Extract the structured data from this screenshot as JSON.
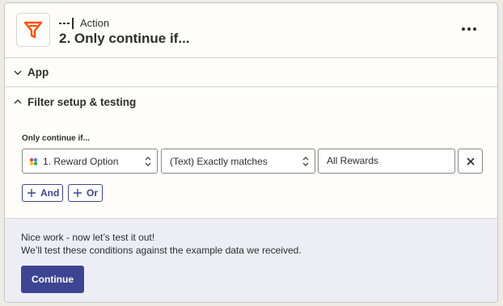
{
  "header": {
    "step_type": "Action",
    "step_title": "2. Only continue if...",
    "icon": "filter-icon",
    "more_icon": "more-horizontal-icon",
    "accent_color": "#ff4f00"
  },
  "sections": {
    "app": {
      "label": "App",
      "icon": "chevron-down-icon"
    },
    "filter": {
      "label": "Filter setup & testing",
      "icon": "chevron-up-icon"
    }
  },
  "filter": {
    "condition_label": "Only continue if...",
    "field": {
      "value": "1. Reward Option",
      "icon": "google-sheets-icon"
    },
    "operator": {
      "value": "(Text) Exactly matches"
    },
    "match_value": {
      "value": "All Rewards"
    },
    "remove_icon": "close-icon",
    "and_label": "And",
    "or_label": "Or"
  },
  "test": {
    "title": "Nice work - now let’s test it out!",
    "subtitle": "We’ll test these conditions against the example data we received.",
    "continue_label": "Continue",
    "button_color": "#3d4592"
  }
}
